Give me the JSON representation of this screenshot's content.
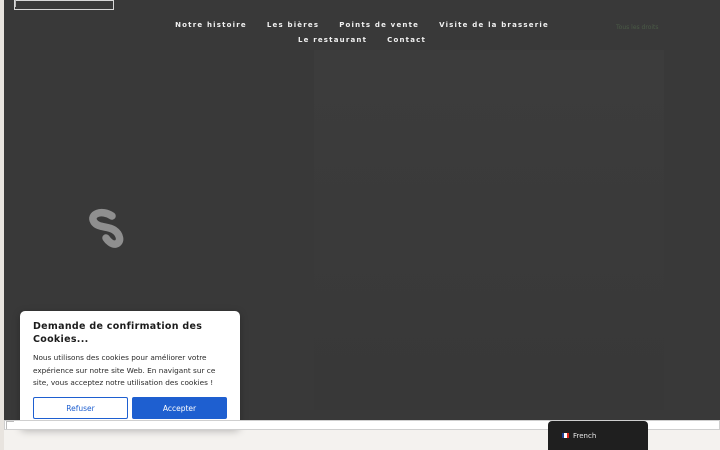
{
  "nav": {
    "row1": [
      "Notre histoire",
      "Les bières",
      "Points de vente",
      "Visite de la brasserie"
    ],
    "row2": [
      "Le restaurant",
      "Contact"
    ]
  },
  "faint_tag": "Tous les droits",
  "cookie": {
    "title": "Demande de confirmation des Cookies...",
    "text": "Nous utilisons des cookies pour améliorer votre expérience sur notre site Web. En navigant sur ce site, vous acceptez notre utilisation des cookies !",
    "refuse_label": "Refuser",
    "accept_label": "Accepter"
  },
  "language": {
    "label": "French",
    "flag_icon": "french-flag-icon"
  },
  "icons": {
    "loader": "loading-spinner-icon",
    "logo": "broken-image-icon"
  },
  "colors": {
    "hero_bg": "#393939",
    "accent_blue": "#1e5fd0",
    "lang_bg": "#1f1f1f"
  }
}
